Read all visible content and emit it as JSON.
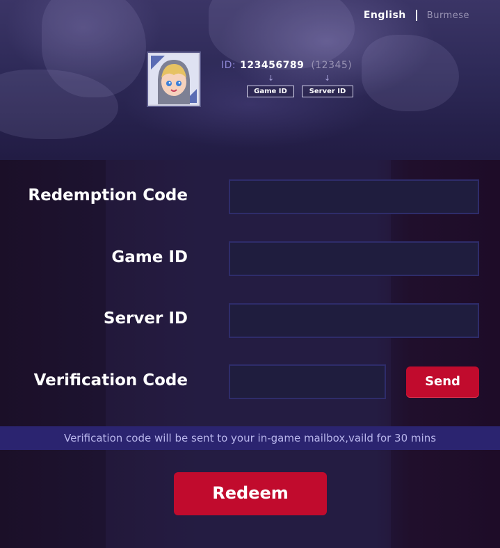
{
  "language": {
    "current": "English",
    "other": "Burmese"
  },
  "profile": {
    "id_label": "ID:",
    "game_id": "123456789",
    "server_id": "(12345)",
    "game_id_tag": "Game ID",
    "server_id_tag": "Server ID",
    "arrow_glyph": "↓"
  },
  "form": {
    "redemption_code_label": "Redemption Code",
    "redemption_code_value": "",
    "game_id_label": "Game ID",
    "game_id_value": "",
    "server_id_label": "Server ID",
    "server_id_value": "",
    "verification_code_label": "Verification Code",
    "verification_code_value": "",
    "send_label": "Send",
    "note": "Verification code will be sent to your in-game mailbox,vaild for 30 mins",
    "redeem_label": "Redeem"
  },
  "colors": {
    "accent_red": "#c10b2d",
    "field_border": "#2e2c6a",
    "note_bar": "#2b2470"
  },
  "icons": {
    "avatar": "hero-avatar-icon",
    "arrow": "arrow-down-icon"
  }
}
